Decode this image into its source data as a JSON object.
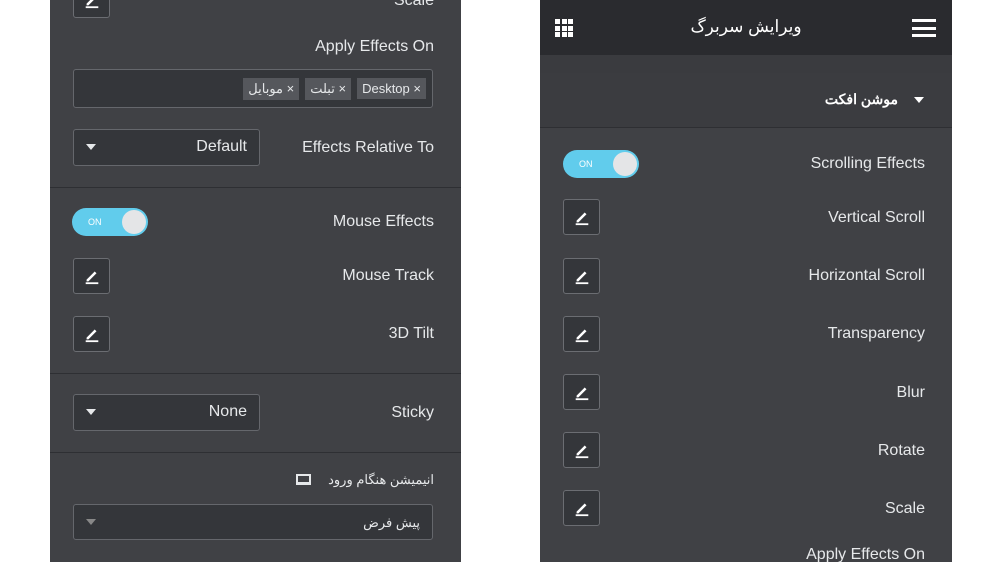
{
  "left_panel": {
    "scale_label": "Scale",
    "apply_effects_label": "Apply Effects On",
    "apply_effects_tags": [
      "Desktop",
      "تبلت",
      "موبایل"
    ],
    "effects_relative_label": "Effects Relative To",
    "effects_relative_value": "Default",
    "mouse_effects_label": "Mouse Effects",
    "mouse_effects_toggle": "ON",
    "mouse_track_label": "Mouse Track",
    "tilt_label": "3D Tilt",
    "sticky_label": "Sticky",
    "sticky_value": "None",
    "entrance_label": "انیمیشن هنگام ورود",
    "entrance_value": "پیش فرض",
    "tag_remove": "×"
  },
  "right_panel": {
    "title": "ویرایش سربرگ",
    "section_title": "موشن افکت",
    "scrolling_effects_label": "Scrolling Effects",
    "scrolling_toggle": "ON",
    "items": [
      "Vertical Scroll",
      "Horizontal Scroll",
      "Transparency",
      "Blur",
      "Rotate",
      "Scale"
    ],
    "apply_effects_label": "Apply Effects On"
  },
  "colors": {
    "panel": "#404145",
    "header": "#2a2b2f",
    "toggle": "#61ccec"
  }
}
